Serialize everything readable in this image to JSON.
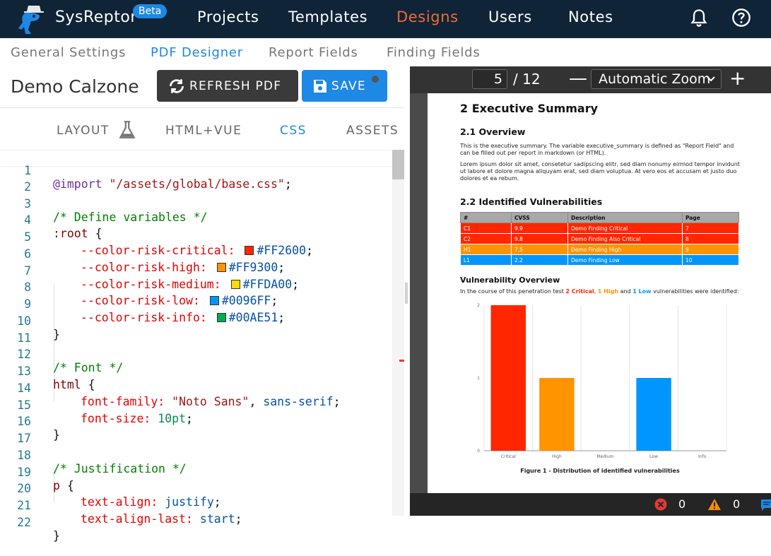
{
  "app": {
    "brand": "SysReptor",
    "badge": "Beta"
  },
  "nav": [
    {
      "label": "Projects",
      "active": false
    },
    {
      "label": "Templates",
      "active": false
    },
    {
      "label": "Designs",
      "active": true
    },
    {
      "label": "Users",
      "active": false
    },
    {
      "label": "Notes",
      "active": false
    }
  ],
  "subnav": [
    {
      "label": "General Settings",
      "active": false
    },
    {
      "label": "PDF Designer",
      "active": true
    },
    {
      "label": "Report Fields",
      "active": false
    },
    {
      "label": "Finding Fields",
      "active": false
    }
  ],
  "design": {
    "title": "Demo Calzone",
    "refresh_label": "REFRESH PDF",
    "save_label": "SAVE"
  },
  "tabs": [
    {
      "label": "LAYOUT",
      "active": false
    },
    {
      "label": "HTML+VUE",
      "active": false
    },
    {
      "label": "CSS",
      "active": true
    },
    {
      "label": "ASSETS",
      "active": false
    }
  ],
  "editor": {
    "line_numbers": [
      "1",
      "2",
      "3",
      "4",
      "5",
      "6",
      "7",
      "8",
      "9",
      "10",
      "11",
      "12",
      "13",
      "14",
      "15",
      "16",
      "17",
      "18",
      "19",
      "20",
      "21",
      "22"
    ],
    "import_path": "\"/assets/global/base.css\"",
    "cmt_variables": "/* Define variables */",
    "cmt_font": "/* Font */",
    "cmt_justify": "/* Justification */",
    "font_family_value": "\"Noto Sans\"",
    "font_size_value": "10pt",
    "variables": [
      {
        "name": "--color-risk-critical:",
        "value": "#FF2600",
        "color": "#FF2600"
      },
      {
        "name": "--color-risk-high:",
        "value": "#FF9300",
        "color": "#FF9300"
      },
      {
        "name": "--color-risk-medium:",
        "value": "#FFDA00",
        "color": "#FFDA00"
      },
      {
        "name": "--color-risk-low:",
        "value": "#0096FF",
        "color": "#0096FF"
      },
      {
        "name": "--color-risk-info:",
        "value": "#00AE51",
        "color": "#00AE51"
      }
    ]
  },
  "pdf": {
    "page_current": "5",
    "page_total": "/ 12",
    "zoom": "Automatic Zoom",
    "h1": "2  Executive Summary",
    "h2_overview": "2.1   Overview",
    "overview_text": "This is the executive summary. The variable executive_summary is defined as \"Report Field\" and can be filled out per report in markdown (or HTML).",
    "lorem": "Lorem ipsum dolor sit amet, consetetur sadipscing elitr, sed diam nonumy eirmod tempor invidunt ut labore et dolore magna aliquyam erat, sed diam voluptua. At vero eos et accusam et justo duo dolores et ea rebum.",
    "h2_vulns": "2.2   Identified Vulnerabilities",
    "table_headers": [
      "#",
      "CVSS",
      "Description",
      "Page"
    ],
    "table_rows": [
      {
        "id": "C1",
        "cvss": "9.9",
        "desc": "Demo Finding Critical",
        "page": "7",
        "color": "#FF2600"
      },
      {
        "id": "C2",
        "cvss": "9.8",
        "desc": "Demo Finding Also Critical",
        "page": "8",
        "color": "#FF2600"
      },
      {
        "id": "H1",
        "cvss": "7.5",
        "desc": "Demo Finding High",
        "page": "9",
        "color": "#FF9300"
      },
      {
        "id": "L1",
        "cvss": "2.2",
        "desc": "Demo Finding Low",
        "page": "10",
        "color": "#0096FF"
      }
    ],
    "vuln_overview_title": "Vulnerability Overview",
    "vuln_sentence_prefix": "In the course of this penetration test ",
    "vuln_critical": "2 Critical",
    "vuln_high": "1 High",
    "vuln_low": "1 Low",
    "vuln_and": " and ",
    "vuln_suffix": " vulnerabilities were identified:",
    "caption": "Figure 1 - Distribution of identified vulnerabilities"
  },
  "chart_data": {
    "type": "bar",
    "categories": [
      "Critical",
      "High",
      "Medium",
      "Low",
      "Info"
    ],
    "values": [
      2,
      1,
      0,
      1,
      0
    ],
    "colors": [
      "#FF2600",
      "#FF9300",
      "#FFDA00",
      "#0096FF",
      "#00AE51"
    ],
    "ylim": [
      0,
      2
    ],
    "yticks": [
      "0",
      "1",
      "2"
    ],
    "title": "",
    "xlabel": "",
    "ylabel": ""
  },
  "status": {
    "errors": "0",
    "warnings": "0"
  }
}
